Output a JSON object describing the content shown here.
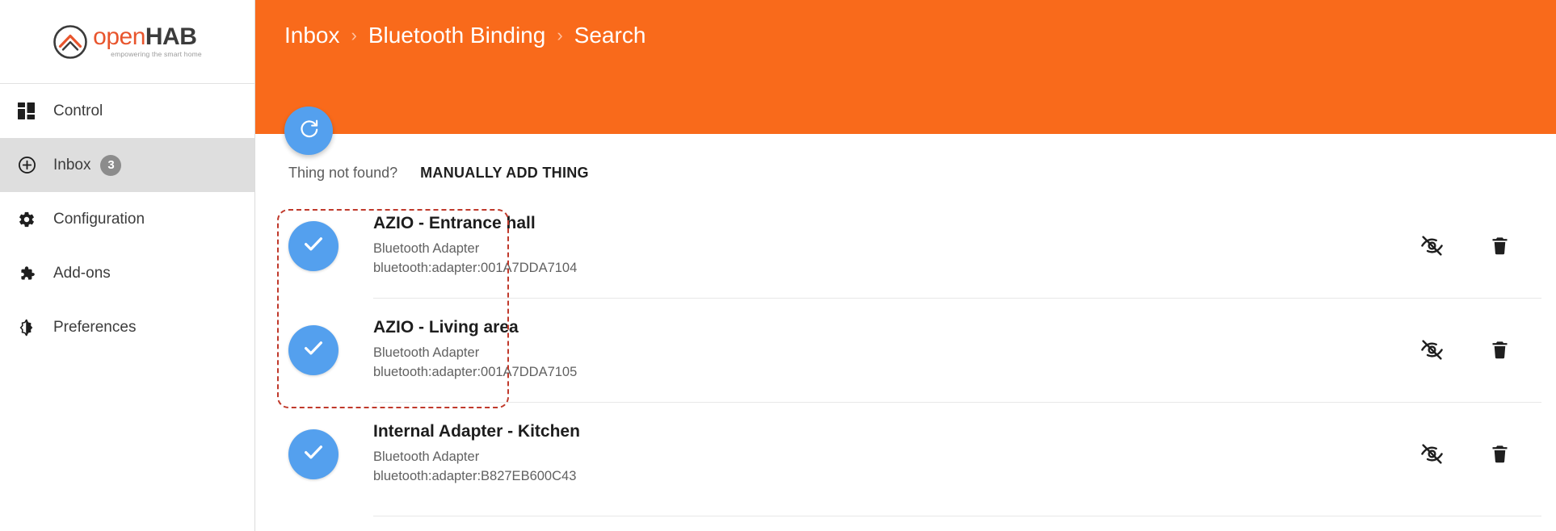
{
  "brand": {
    "name_open": "open",
    "name_hab": "HAB",
    "tagline": "empowering the smart home",
    "logo_icon": "openhab-logo-icon"
  },
  "sidebar": {
    "items": [
      {
        "label": "Control",
        "icon": "dashboard-icon",
        "active": false,
        "badge": null
      },
      {
        "label": "Inbox",
        "icon": "plus-circle-icon",
        "active": true,
        "badge": "3"
      },
      {
        "label": "Configuration",
        "icon": "gear-icon",
        "active": false,
        "badge": null
      },
      {
        "label": "Add-ons",
        "icon": "puzzle-piece-icon",
        "active": false,
        "badge": null
      },
      {
        "label": "Preferences",
        "icon": "brightness-contrast-icon",
        "active": false,
        "badge": null
      }
    ]
  },
  "header": {
    "breadcrumb": [
      "Inbox",
      "Bluetooth Binding",
      "Search"
    ],
    "separator": "›",
    "background_color": "#f96a1b"
  },
  "refresh_button": {
    "icon": "refresh-icon",
    "color": "#54a0ee"
  },
  "not_found": {
    "text": "Thing not found?",
    "button_label": "MANUALLY ADD THING"
  },
  "things": [
    {
      "title": "AZIO - Entrance hall",
      "type": "Bluetooth Adapter",
      "uid": "bluetooth:adapter:001A7DDA7104",
      "avatar_icon": "check-icon",
      "hide_icon": "eye-off-icon",
      "delete_icon": "trash-icon"
    },
    {
      "title": "AZIO - Living area",
      "type": "Bluetooth Adapter",
      "uid": "bluetooth:adapter:001A7DDA7105",
      "avatar_icon": "check-icon",
      "hide_icon": "eye-off-icon",
      "delete_icon": "trash-icon"
    },
    {
      "title": "Internal Adapter - Kitchen",
      "type": "Bluetooth Adapter",
      "uid": "bluetooth:adapter:B827EB600C43",
      "avatar_icon": "check-icon",
      "hide_icon": "eye-off-icon",
      "delete_icon": "trash-icon"
    }
  ],
  "annotation": {
    "color": "#c0392b",
    "style": "dashed-rounded-rectangle"
  }
}
